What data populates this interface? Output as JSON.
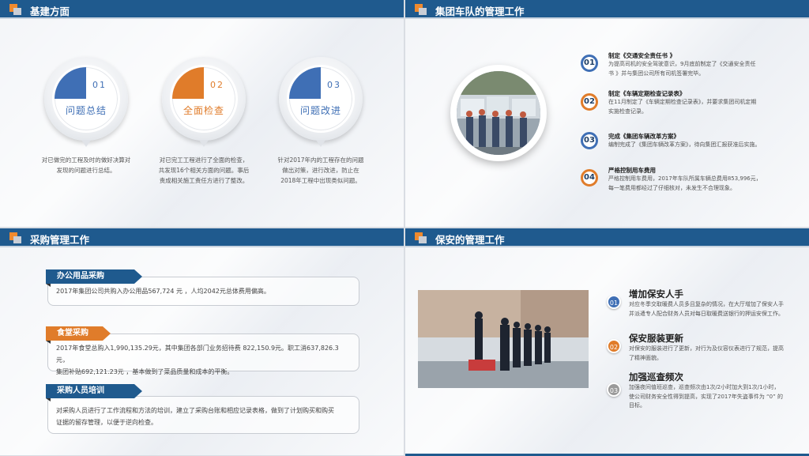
{
  "colors": {
    "header": "#1f5a8e",
    "blue": "#3f6fb5",
    "orange": "#e07c2a",
    "gray": "#9a9a9a"
  },
  "slide1": {
    "title": "基建方面",
    "circles": [
      {
        "num": "01",
        "label": "问题总结",
        "color": "#3f6fb5",
        "desc": [
          "对已做完的工程及时的做好决算对",
          "发现的问题进行总结。"
        ]
      },
      {
        "num": "02",
        "label": "全面检查",
        "color": "#e07c2a",
        "desc": [
          "对已完工工程进行了全面的检查，",
          "共发现16个相关方面的问题。事后",
          "责成相关施工责任方进行了整改。"
        ]
      },
      {
        "num": "03",
        "label": "问题改进",
        "color": "#3f6fb5",
        "desc": [
          "针对2017年内的工程存在的问题",
          "做出对策，进行改进，防止在",
          "2018年工程中出现类似问题。"
        ]
      }
    ]
  },
  "slide2": {
    "title": "集团车队的管理工作",
    "items": [
      {
        "num": "01",
        "title": "制定《交通安全责任书 》",
        "desc": [
          "为提高司机的安全驾驶意识，9月底前制定了《交通安全责任",
          "书 》并与集团公司所有司机签署完毕。"
        ]
      },
      {
        "num": "02",
        "title": "制定《车辆定期检查记录表》",
        "desc": [
          "在11月制定了《车辆定期检查记录表》，并要求集团司机定期",
          "实施检查记录。"
        ]
      },
      {
        "num": "03",
        "title": "完成《集团车辆改革方案》",
        "desc": [
          "编制完成了《集团车辆改革方案》，待向集团汇报获准后实施。"
        ]
      },
      {
        "num": "04",
        "title": "严格控制用车费用",
        "desc": [
          "严格控制用车费用，2017年车队所属车辆总费用853,996元，",
          "每一笔费用都经过了仔细核对，未发生不合理现象。"
        ]
      }
    ]
  },
  "slide3": {
    "title": "采购管理工作",
    "sections": [
      {
        "tag": "办公用品采购",
        "color": "#1f5a8e",
        "text": [
          "2017年集团公司共购入办公用品567,724 元 ，人均2042元总体费用偏高。"
        ]
      },
      {
        "tag": "食堂采购",
        "color": "#e07c2a",
        "text": [
          "2017年食堂总购入1,990,135.29元，其中集团各部门业务招待费 822,150.9元。职工消637,826.3元，",
          "集团补贴692,121.23元 ，基本做到了菜品质量和成本的平衡。"
        ]
      },
      {
        "tag": "采购人员培训",
        "color": "#1f5a8e",
        "text": [
          "对采购人员进行了工作流程和方法的培训，建立了采购台账和相应记录表格，做到了计划购买和购买",
          "证据的留存管理，以便于逆向检查。"
        ]
      }
    ]
  },
  "slide4": {
    "title": "保安的管理工作",
    "items": [
      {
        "num": "01",
        "color": "#3f6fb5",
        "title": "增加保安人手",
        "desc": [
          "对应冬季交取暖费人员多且复杂的情况，在大厅增加了保安人手",
          "并派遣专人配合财务人员对每日取暖费送银行的押运安保工作。"
        ]
      },
      {
        "num": "02",
        "color": "#e07c2a",
        "title": "保安服装更新",
        "desc": [
          "对保安的服装进行了更新，对行为及仪容仪表进行了规范，提高",
          "了精神面貌。"
        ]
      },
      {
        "num": "03",
        "color": "#9a9a9a",
        "title": "加强巡查频次",
        "desc": [
          "加强夜间值班巡查，巡查频次由1次/2小时加大到1次/1小时，",
          "使公司财务安全性得到提高，实现了2017年失盗事件为 “0” 的",
          "目标。"
        ]
      }
    ]
  }
}
